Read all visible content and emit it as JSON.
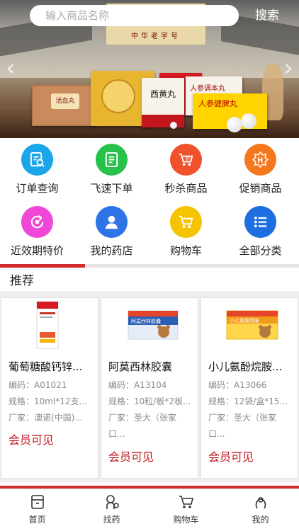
{
  "search": {
    "placeholder": "输入商品名称",
    "button_label": "搜索"
  },
  "banner": {
    "sign_text": "中华老字号",
    "box1_label": "活血丸",
    "box3_label": "西黄丸",
    "box5_label": "人参调本丸",
    "box6_label": "人参健脾丸"
  },
  "grid": {
    "items": [
      {
        "label": "订单查询",
        "icon": "order-search-icon",
        "color": "#1aa6e8"
      },
      {
        "label": "飞速下单",
        "icon": "fast-order-icon",
        "color": "#27c24c"
      },
      {
        "label": "秒杀商品",
        "icon": "flash-sale-icon",
        "color": "#f0522e"
      },
      {
        "label": "促销商品",
        "icon": "promotion-icon",
        "color": "#f5781f"
      },
      {
        "label": "近效期特价",
        "icon": "expiry-special-icon",
        "color": "#ef47d8"
      },
      {
        "label": "我的药店",
        "icon": "my-pharmacy-icon",
        "color": "#2f74e6"
      },
      {
        "label": "购物车",
        "icon": "cart-icon",
        "color": "#f5c400"
      },
      {
        "label": "全部分类",
        "icon": "all-categories-icon",
        "color": "#1d6fe0"
      }
    ]
  },
  "recommend": {
    "title": "推荐",
    "products": [
      {
        "name": "葡萄糖酸钙锌...",
        "code": "编码：A01021",
        "spec": "规格：10ml*12支...",
        "maker": "厂家：澳诺(中国)...",
        "maker2": "",
        "price_text": "会员可见"
      },
      {
        "name": "阿莫西林胶囊",
        "code": "编码：A13104",
        "spec": "规格：10粒/板*2板...",
        "maker": "厂家：圣大（张家",
        "maker2": "口...",
        "price_text": "会员可见"
      },
      {
        "name": "小儿氨酚烷胺...",
        "code": "编码：A13066",
        "spec": "规格：12袋/盒*15...",
        "maker": "厂家：圣大（张家",
        "maker2": "口...",
        "price_text": "会员可见"
      }
    ]
  },
  "tabbar": {
    "items": [
      {
        "label": "首页",
        "icon": "home-icon"
      },
      {
        "label": "找药",
        "icon": "find-medicine-icon"
      },
      {
        "label": "购物车",
        "icon": "cart-icon"
      },
      {
        "label": "我的",
        "icon": "profile-icon"
      }
    ]
  },
  "colors": {
    "accent": "#d12b2b",
    "price": "#c4161c"
  }
}
